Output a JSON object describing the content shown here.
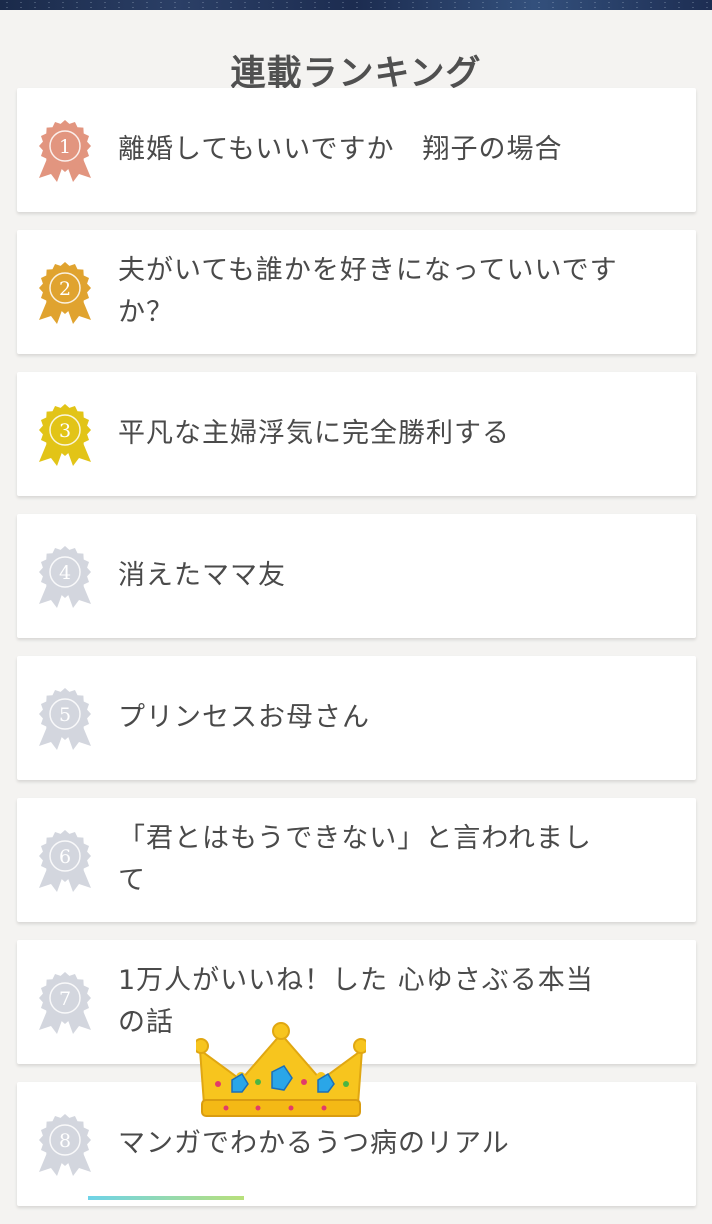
{
  "header": {
    "title": "連載ランキング"
  },
  "colors": {
    "gold_rank1": "#e2957f",
    "gold_rank2": "#e0a32f",
    "gold_rank3": "#e2c417",
    "gray_rank": "#d3d6de"
  },
  "ranking": [
    {
      "rank": "1",
      "title": "離婚してもいいですか　翔子の場合"
    },
    {
      "rank": "2",
      "title": "夫がいても誰かを好きになっていいですか？"
    },
    {
      "rank": "3",
      "title": "平凡な主婦浮気に完全勝利する"
    },
    {
      "rank": "4",
      "title": "消えたママ友"
    },
    {
      "rank": "5",
      "title": "プリンセスお母さん"
    },
    {
      "rank": "6",
      "title": "「君とはもうできない」と言われまして"
    },
    {
      "rank": "7",
      "title": "1万人がいいね！した 心ゆさぶる本当の話"
    },
    {
      "rank": "8",
      "title": "マンガでわかるうつ病のリアル"
    }
  ],
  "decorations": {
    "crown_icon": "crown-emoji-icon",
    "badge_icon": "rosette-badge-icon"
  }
}
